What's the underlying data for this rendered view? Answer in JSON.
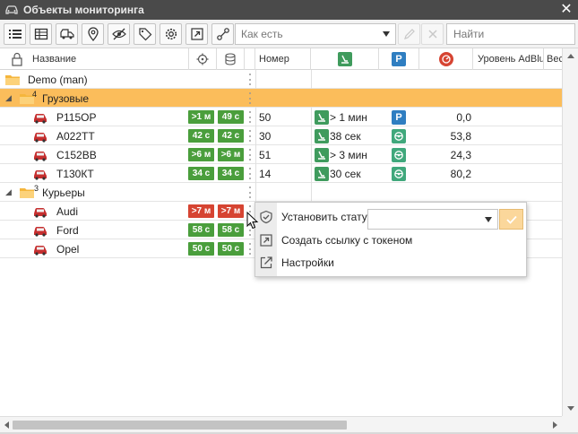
{
  "window": {
    "title": "Объекты мониторинга",
    "close_icon": "close-icon"
  },
  "toolbar": {
    "buttons": [
      "list-icon",
      "table-icon",
      "vehicles-icon",
      "geofence-icon",
      "hidden-eye-icon",
      "tag-icon",
      "gear-icon",
      "share-link-icon",
      "connect-icon"
    ],
    "status_select_value": "Как есть",
    "search_placeholder": "Найти"
  },
  "columns": {
    "name": "Название",
    "number": "Номер",
    "adblue": "Уровень AdBlue",
    "weight": "Вес"
  },
  "rows": [
    {
      "kind": "group",
      "label": "Demo (man)",
      "count": ""
    },
    {
      "kind": "group",
      "label": "Грузовые",
      "count": "4",
      "selected": true
    },
    {
      "kind": "vehicle",
      "name": "Р115ОР",
      "b1": ">1 м",
      "b1c": "green",
      "b2": "49 с",
      "b2c": "green",
      "number": "50",
      "motion": "> 1 мин",
      "parking": "parking",
      "value": "0,0"
    },
    {
      "kind": "vehicle",
      "name": "А022ТТ",
      "b1": "42 с",
      "b1c": "green",
      "b2": "42 с",
      "b2c": "green",
      "number": "30",
      "motion": "38 сек",
      "parking": "ignition",
      "value": "53,8"
    },
    {
      "kind": "vehicle",
      "name": "С152ВВ",
      "b1": ">6 м",
      "b1c": "green",
      "b2": ">6 м",
      "b2c": "green",
      "number": "51",
      "motion": "> 3 мин",
      "parking": "ignition",
      "value": "24,3"
    },
    {
      "kind": "vehicle",
      "name": "Т130КТ",
      "b1": "34 с",
      "b1c": "green",
      "b2": "34 с",
      "b2c": "green",
      "number": "14",
      "motion": "30 сек",
      "parking": "ignition",
      "value": "80,2"
    },
    {
      "kind": "group",
      "label": "Курьеры",
      "count": "3"
    },
    {
      "kind": "vehicle",
      "name": "Audi",
      "b1": ">7 м",
      "b1c": "red",
      "b2": ">7 м",
      "b2c": "red",
      "number": "",
      "motion": "",
      "parking": "",
      "value": ""
    },
    {
      "kind": "vehicle",
      "name": "Ford",
      "b1": "58 с",
      "b1c": "green",
      "b2": "58 с",
      "b2c": "green",
      "number": "",
      "motion": "",
      "parking": "",
      "value": ""
    },
    {
      "kind": "vehicle",
      "name": "Opel",
      "b1": "50 с",
      "b1c": "green",
      "b2": "50 с",
      "b2c": "green",
      "number": "",
      "motion": "",
      "parking": "",
      "value": ""
    }
  ],
  "context_menu": {
    "set_status": "Установить статус",
    "token_link": "Создать ссылку с токеном",
    "settings": "Настройки"
  },
  "colors": {
    "selected_row": "#fbbd5b",
    "badge_green": "#4a9e3c",
    "badge_red": "#d64432",
    "titlebar": "#4a4a4a"
  }
}
